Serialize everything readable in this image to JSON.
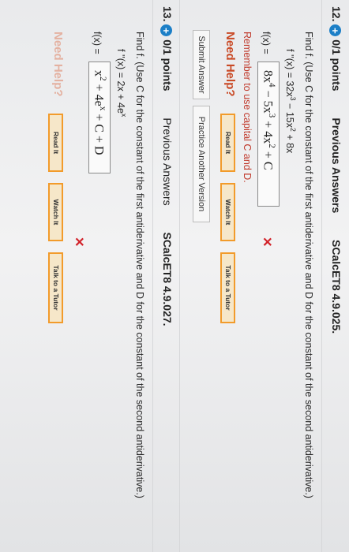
{
  "q12": {
    "number": "12.",
    "points": "0/1 points",
    "prev": "Previous Answers",
    "code": "SCalcET8 4.9.025.",
    "instruction": "Find f. (Use C for the constant of the first antiderivative and D for the constant of the second antiderivative.)",
    "given_lhs": "f ''(x) = 32x",
    "given_e1": "3",
    "given_mid": " − 15x",
    "given_e2": "2",
    "given_end": " + 8x",
    "f_label": "f(x) =",
    "answer_a": "8x",
    "answer_e1": "4",
    "answer_b": " − 5x",
    "answer_e2": "3",
    "answer_c": " + 4x",
    "answer_e3": "2",
    "answer_d": " + C",
    "remember": "Remember to use capital C and D.",
    "need_help": "Need Help?",
    "read_it": "Read It",
    "watch_it": "Watch It",
    "talk_tutor": "Talk to a Tutor",
    "submit": "Submit Answer",
    "practice": "Practice Another Version"
  },
  "q13": {
    "number": "13.",
    "points": "0/1 points",
    "prev": "Previous Answers",
    "code": "SCalcET8 4.9.027.",
    "instruction": "Find f. (Use C for the constant of the first antiderivative and D for the constant of the second antiderivative.)",
    "given_lhs": "f ''(x) = 2x + 4e",
    "given_e1": "x",
    "f_label": "f(x) =",
    "answer_a": "x",
    "answer_e1": "2",
    "answer_b": " + 4e",
    "answer_e2": "x",
    "answer_c": " + C + D",
    "need_help": "Need Help?",
    "read_it": "Read It",
    "watch_it": "Watch It",
    "talk_tutor": "Talk to a Tutor"
  }
}
